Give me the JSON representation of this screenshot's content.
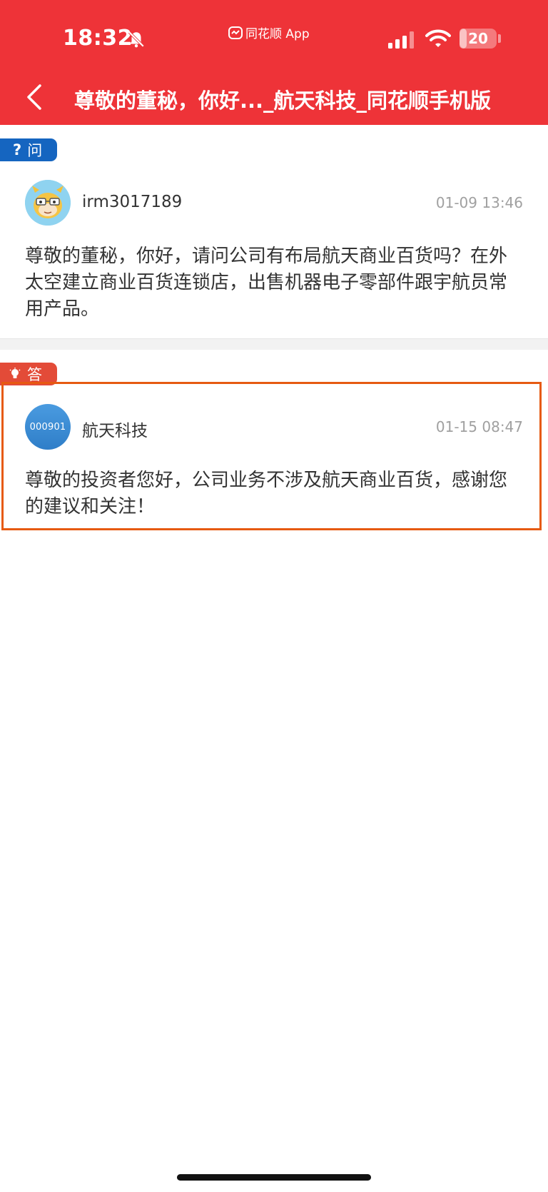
{
  "status_bar": {
    "time": "18:32",
    "app_indicator": "同花顺 App",
    "battery_level": "20",
    "battery_fraction": 0.2,
    "icons": [
      "bell-muted-icon",
      "signal-icon",
      "wifi-icon",
      "battery-icon"
    ]
  },
  "nav": {
    "title": "尊敬的董秘，你好..._航天科技_同花顺手机版",
    "back_icon": "chevron-left-icon"
  },
  "question": {
    "tag_label": "问",
    "tag_glyph": "?",
    "tag_color": "#1565c0",
    "user": "irm3017189",
    "time": "01-09 13:46",
    "text": "尊敬的董秘，你好，请问公司有布局航天商业百货吗？在外太空建立商业百货连锁店，出售机器电子零部件跟宇航员常用产品。"
  },
  "answer": {
    "tag_label": "答",
    "tag_icon": "lightbulb-icon",
    "tag_color": "#e34b38",
    "avatar_code": "000901",
    "user": "航天科技",
    "time": "01-15 08:47",
    "text": "尊敬的投资者您好，公司业务不涉及航天商业百货，感谢您的建议和关注！"
  },
  "colors": {
    "header_bg": "#ee3338",
    "highlight_border": "#e65a12"
  }
}
